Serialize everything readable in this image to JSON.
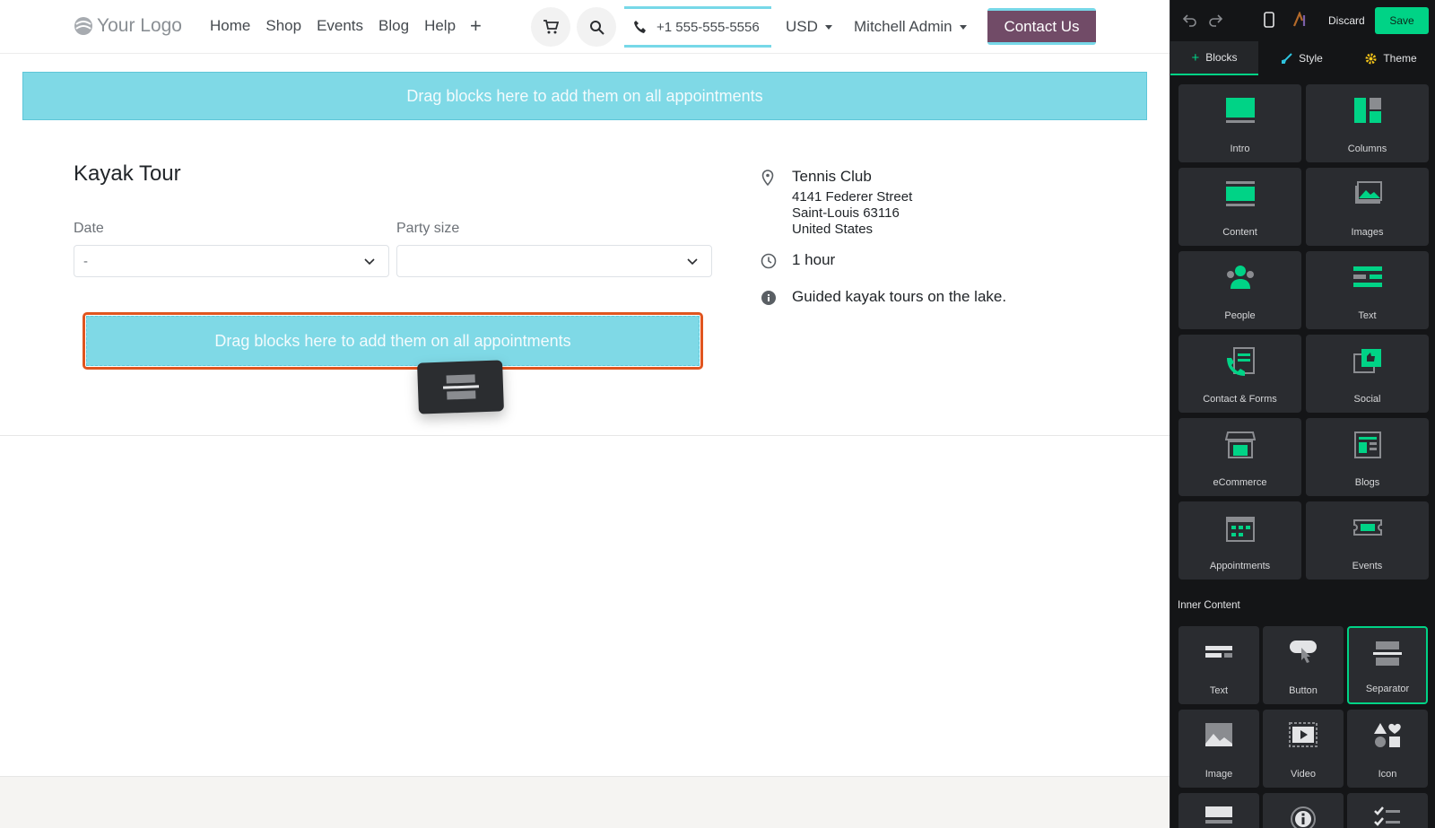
{
  "site": {
    "logo_text": "Your Logo",
    "nav": [
      "Home",
      "Shop",
      "Events",
      "Blog",
      "Help"
    ],
    "nav_plus": "+",
    "phone": "+1 555-555-5556",
    "currency": "USD",
    "user": "Mitchell Admin",
    "contact_button": "Contact Us"
  },
  "dropzones": {
    "top": "Drag blocks here to add them on all appointments",
    "middle": "Drag blocks here to add them on all appointments"
  },
  "appointment": {
    "title": "Kayak Tour",
    "date_label": "Date",
    "date_value": "-",
    "party_label": "Party size",
    "party_value": "",
    "location": {
      "name": "Tennis Club",
      "street": "4141 Federer Street",
      "city": "Saint-Louis 63116",
      "country": "United States"
    },
    "duration": "1 hour",
    "description": "Guided kayak tours on the lake."
  },
  "panel": {
    "discard": "Discard",
    "save": "Save",
    "tabs": [
      "Blocks",
      "Style",
      "Theme"
    ],
    "blocks": [
      "Intro",
      "Columns",
      "Content",
      "Images",
      "People",
      "Text",
      "Contact & Forms",
      "Social",
      "eCommerce",
      "Blogs",
      "Appointments",
      "Events"
    ],
    "inner_content_label": "Inner Content",
    "inner": [
      "Text",
      "Button",
      "Separator",
      "Image",
      "Video",
      "Icon"
    ],
    "selected_inner": "Separator",
    "accent": "#00d386"
  }
}
